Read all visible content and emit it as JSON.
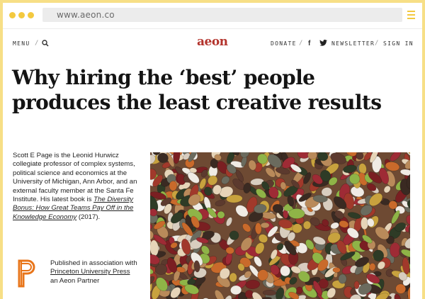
{
  "browser": {
    "url": "www.aeon.co"
  },
  "nav": {
    "menu": "MENU",
    "separator": "/",
    "logo": "aeon",
    "donate": "DONATE",
    "facebook": "f",
    "newsletter": "NEWSLETTER",
    "sign_in": "SIGN IN"
  },
  "article": {
    "title_line1": "Why hiring the ‘best’ people",
    "title_line2": "produces the least creative results"
  },
  "author": {
    "bio_text": "Scott E Page is the Leonid Hurwicz collegiate professor of complex systems, political science and economics at the University of Michigan, Ann Arbor, and an external faculty member at the Santa Fe Institute. His latest book is",
    "book_title": "The Diversity Bonus: How Great Teams Pay Off in the Knowledge Economy",
    "book_year": "(2017)."
  },
  "publisher": {
    "published_line": "Published in association with",
    "partner_name": "Princeton University Press",
    "partner_suffix": "an Aeon Partner"
  },
  "colors": {
    "accent": "#f3c93f",
    "logo": "#b3332c",
    "frame": "#f7df86",
    "pup_orange": "#e8751a"
  }
}
